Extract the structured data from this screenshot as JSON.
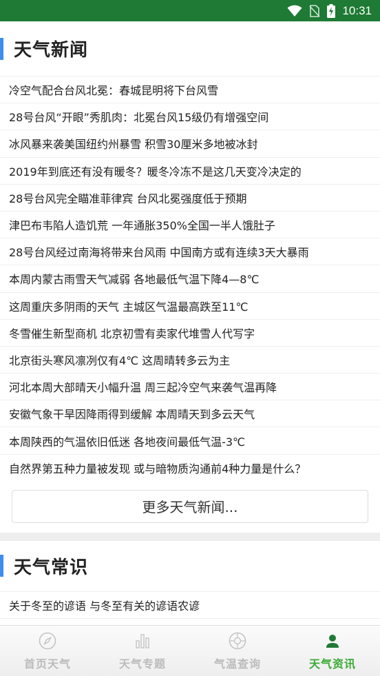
{
  "status_bar": {
    "time": "10:31"
  },
  "news_section": {
    "title": "天气新闻",
    "items": [
      "冷空气配合台风北冕：春城昆明将下台风雪",
      "28号台风“开眼”秀肌肉：北冕台风15级仍有增强空间",
      "冰风暴来袭美国纽约州暴雪 积雪30厘米多地被冰封",
      "2019年到底还有没有暖冬？暖冬冷冻不是这几天变冷决定的",
      "28号台风完全瞄准菲律宾 台风北冕强度低于预期",
      "津巴布韦陷人造饥荒 一年通胀350%全国一半人饿肚子",
      "28号台风经过南海将带来台风雨 中国南方或有连续3天大暴雨",
      "本周内蒙古雨雪天气减弱 各地最低气温下降4—8℃",
      "这周重庆多阴雨的天气 主城区气温最高跌至11℃",
      "冬雪催生新型商机 北京初雪有卖家代堆雪人代写字",
      "北京街头寒风凛冽仅有4℃ 这周晴转多云为主",
      "河北本周大部晴天小幅升温 周三起冷空气来袭气温再降",
      "安徽气象干旱因降雨得到缓解 本周晴天到多云天气",
      "本周陕西的气温依旧低迷 各地夜间最低气温-3℃",
      "自然界第五种力量被发现 或与暗物质沟通前4种力量是什么？"
    ],
    "more_label": "更多天气新闻..."
  },
  "knowledge_section": {
    "title": "天气常识",
    "items": [
      "关于冬至的谚语 与冬至有关的谚语农谚"
    ]
  },
  "bottom_nav": [
    {
      "label": "首页天气",
      "icon": "compass-icon",
      "active": false
    },
    {
      "label": "天气专题",
      "icon": "bar-chart-icon",
      "active": false
    },
    {
      "label": "气温查询",
      "icon": "ball-icon",
      "active": false
    },
    {
      "label": "天气资讯",
      "icon": "person-icon",
      "active": true
    }
  ],
  "colors": {
    "status_bar": "#1e7a34",
    "accent_bar": "#3d8ef0",
    "nav_active": "#3aaa35",
    "nav_inactive": "#bbbbbb"
  }
}
